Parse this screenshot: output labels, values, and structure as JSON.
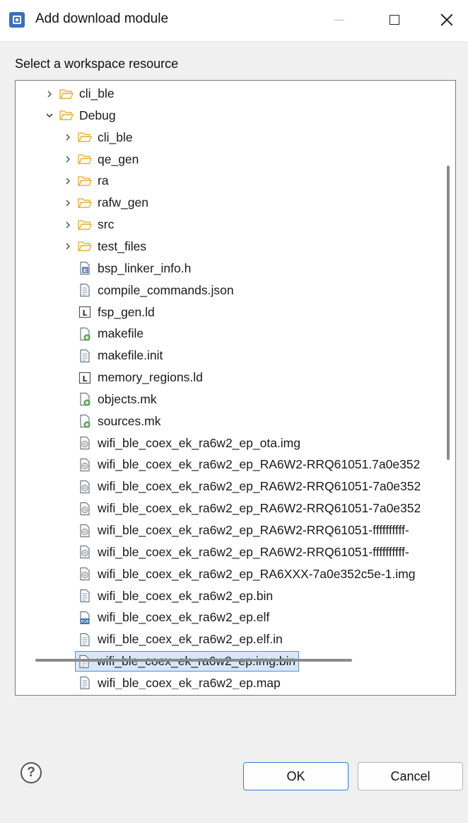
{
  "window": {
    "title": "Add download module",
    "icon": "e2studio-app-icon"
  },
  "prompt": "Select a workspace resource",
  "tree": {
    "rows": [
      {
        "label": "cli_ble",
        "indent": 1,
        "expander": "collapsed",
        "icon": "folder-open"
      },
      {
        "label": "Debug",
        "indent": 1,
        "expander": "expanded",
        "icon": "folder-open"
      },
      {
        "label": "cli_ble",
        "indent": 2,
        "expander": "collapsed",
        "icon": "folder-open"
      },
      {
        "label": "qe_gen",
        "indent": 2,
        "expander": "collapsed",
        "icon": "folder-open"
      },
      {
        "label": "ra",
        "indent": 2,
        "expander": "collapsed",
        "icon": "folder-open"
      },
      {
        "label": "rafw_gen",
        "indent": 2,
        "expander": "collapsed",
        "icon": "folder-open"
      },
      {
        "label": "src",
        "indent": 2,
        "expander": "collapsed",
        "icon": "folder-open"
      },
      {
        "label": "test_files",
        "indent": 2,
        "expander": "collapsed",
        "icon": "folder-open"
      },
      {
        "label": "bsp_linker_info.h",
        "indent": 2,
        "expander": "none",
        "icon": "c-header-file"
      },
      {
        "label": "compile_commands.json",
        "indent": 2,
        "expander": "none",
        "icon": "text-file"
      },
      {
        "label": "fsp_gen.ld",
        "indent": 2,
        "expander": "none",
        "icon": "linker-file"
      },
      {
        "label": "makefile",
        "indent": 2,
        "expander": "none",
        "icon": "make-file"
      },
      {
        "label": "makefile.init",
        "indent": 2,
        "expander": "none",
        "icon": "text-file"
      },
      {
        "label": "memory_regions.ld",
        "indent": 2,
        "expander": "none",
        "icon": "linker-file"
      },
      {
        "label": "objects.mk",
        "indent": 2,
        "expander": "none",
        "icon": "make-file"
      },
      {
        "label": "sources.mk",
        "indent": 2,
        "expander": "none",
        "icon": "make-file"
      },
      {
        "label": "wifi_ble_coex_ek_ra6w2_ep_ota.img",
        "indent": 2,
        "expander": "none",
        "icon": "image-file"
      },
      {
        "label": "wifi_ble_coex_ek_ra6w2_ep_RA6W2-RRQ61051.7a0e352",
        "indent": 2,
        "expander": "none",
        "icon": "image-file"
      },
      {
        "label": "wifi_ble_coex_ek_ra6w2_ep_RA6W2-RRQ61051-7a0e352",
        "indent": 2,
        "expander": "none",
        "icon": "image-file"
      },
      {
        "label": "wifi_ble_coex_ek_ra6w2_ep_RA6W2-RRQ61051-7a0e352",
        "indent": 2,
        "expander": "none",
        "icon": "image-file"
      },
      {
        "label": "wifi_ble_coex_ek_ra6w2_ep_RA6W2-RRQ61051-ffffffffff-",
        "indent": 2,
        "expander": "none",
        "icon": "image-file"
      },
      {
        "label": "wifi_ble_coex_ek_ra6w2_ep_RA6W2-RRQ61051-ffffffffff-",
        "indent": 2,
        "expander": "none",
        "icon": "image-file"
      },
      {
        "label": "wifi_ble_coex_ek_ra6w2_ep_RA6XXX-7a0e352c5e-1.img",
        "indent": 2,
        "expander": "none",
        "icon": "image-file"
      },
      {
        "label": "wifi_ble_coex_ek_ra6w2_ep.bin",
        "indent": 2,
        "expander": "none",
        "icon": "text-file"
      },
      {
        "label": "wifi_ble_coex_ek_ra6w2_ep.elf",
        "indent": 2,
        "expander": "none",
        "icon": "binary-file"
      },
      {
        "label": "wifi_ble_coex_ek_ra6w2_ep.elf.in",
        "indent": 2,
        "expander": "none",
        "icon": "text-file"
      },
      {
        "label": "wifi_ble_coex_ek_ra6w2_ep.img.bin",
        "indent": 2,
        "expander": "none",
        "icon": "text-file",
        "selected": true
      },
      {
        "label": "wifi_ble_coex_ek_ra6w2_ep.map",
        "indent": 2,
        "expander": "none",
        "icon": "text-file"
      }
    ]
  },
  "buttons": {
    "ok": "OK",
    "cancel": "Cancel",
    "help": "?"
  },
  "colors": {
    "selection_fill": "#d7e6fa",
    "selection_border": "#5a8fd6",
    "ok_border": "#2a7de1",
    "folder": "#e8b335"
  }
}
